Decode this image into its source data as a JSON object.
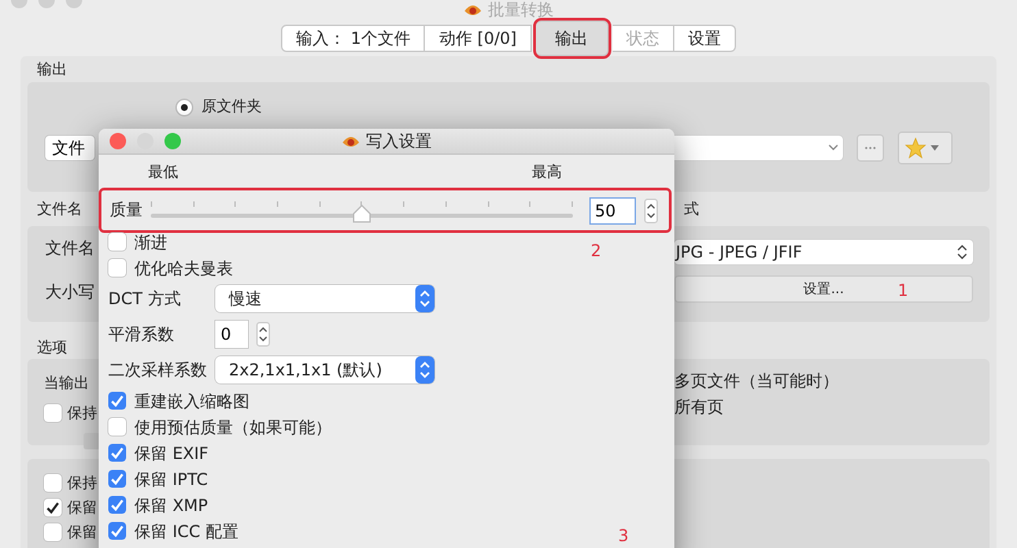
{
  "window": {
    "title": "批量转换"
  },
  "tabs": [
    {
      "label": "输入： 1个文件",
      "selected": false,
      "disabled": false
    },
    {
      "label": "动作 [0/0]",
      "selected": false,
      "disabled": false
    },
    {
      "label": "输出",
      "selected": true,
      "disabled": false
    },
    {
      "label": "状态",
      "selected": false,
      "disabled": true
    },
    {
      "label": "设置",
      "selected": false,
      "disabled": false
    }
  ],
  "output_section": {
    "label": "输出",
    "radio": {
      "label": "原文件夹",
      "selected": true
    },
    "folder_popup": "文件"
  },
  "filename_section": {
    "label": "文件名",
    "format_label": "式",
    "rows": [
      "文件名",
      "大小写"
    ],
    "format_popup": "JPG - JPEG / JFIF",
    "settings_button": "设置..."
  },
  "options_section": {
    "label": "选项",
    "when_output": "当输出",
    "keep": {
      "label": "保持",
      "checked": false
    },
    "sub_check": {
      "checked": false,
      "disabled": true
    },
    "multipage": "多页文件（当可能时）",
    "all_pages": "所有页"
  },
  "metadata_checks": [
    {
      "label": "保持",
      "checked": false
    },
    {
      "label": "保留",
      "checked": true
    },
    {
      "label": "保留",
      "checked": false
    }
  ],
  "dialog": {
    "title": "写入设置",
    "min_label": "最低",
    "max_label": "最高",
    "quality": {
      "label": "质量",
      "level": 0.5,
      "value": "50"
    },
    "options": [
      {
        "kind": "checkbox",
        "label": "渐进",
        "checked": false
      },
      {
        "kind": "checkbox",
        "label": "优化哈夫曼表",
        "checked": false
      },
      {
        "kind": "select",
        "label": "DCT 方式",
        "value": "慢速"
      },
      {
        "kind": "stepper",
        "label": "平滑系数",
        "value": "0"
      },
      {
        "kind": "select",
        "label": "二次采样系数",
        "value": "2x2,1x1,1x1 (默认)"
      },
      {
        "kind": "checkbox",
        "label": "重建嵌入缩略图",
        "checked": true
      },
      {
        "kind": "checkbox",
        "label": "使用预估质量（如果可能）",
        "checked": false
      },
      {
        "kind": "checkbox",
        "label": "保留 EXIF",
        "checked": true
      },
      {
        "kind": "checkbox",
        "label": "保留 IPTC",
        "checked": true
      },
      {
        "kind": "checkbox",
        "label": "保留 XMP",
        "checked": true
      },
      {
        "kind": "checkbox",
        "label": "保留 ICC 配置",
        "checked": true
      }
    ]
  },
  "annotations": [
    "1",
    "2",
    "3"
  ]
}
